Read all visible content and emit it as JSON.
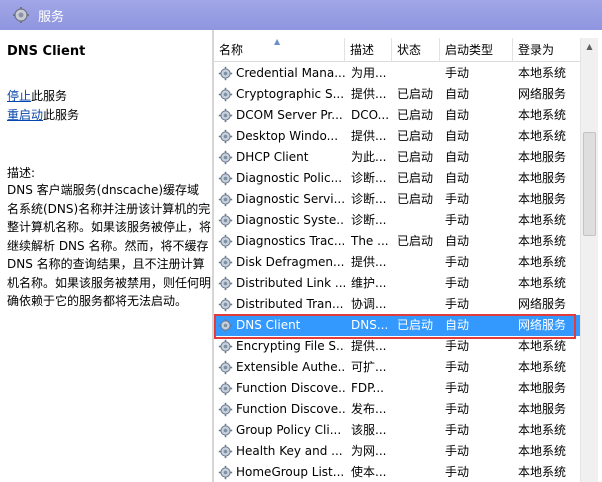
{
  "window": {
    "title": "服务",
    "title_icon": "gear-icon",
    "accent": "#969de1"
  },
  "detail": {
    "service_name": "DNS Client",
    "action_stop_link": "停止",
    "action_stop_suffix": "此服务",
    "action_restart_link": "重启动",
    "action_restart_suffix": "此服务",
    "description_label": "描述:",
    "description_text": "DNS 客户端服务(dnscache)缓存域名系统(DNS)名称并注册该计算机的完整计算机名称。如果该服务被停止，将继续解析 DNS 名称。然而，将不缓存 DNS 名称的查询结果，且不注册计算机名称。如果该服务被禁用，则任何明确依赖于它的服务都将无法启动。"
  },
  "columns": {
    "name": "名称",
    "desc": "描述",
    "status": "状态",
    "start": "启动类型",
    "logon": "登录为"
  },
  "rows": [
    {
      "name": "Credential Mana...",
      "desc": "为用...",
      "status": "",
      "start": "手动",
      "logon": "本地系统"
    },
    {
      "name": "Cryptographic S...",
      "desc": "提供...",
      "status": "已启动",
      "start": "自动",
      "logon": "网络服务"
    },
    {
      "name": "DCOM Server Pr...",
      "desc": "DCO...",
      "status": "已启动",
      "start": "自动",
      "logon": "本地系统"
    },
    {
      "name": "Desktop Windo...",
      "desc": "提供...",
      "status": "已启动",
      "start": "自动",
      "logon": "本地系统"
    },
    {
      "name": "DHCP Client",
      "desc": "为此...",
      "status": "已启动",
      "start": "自动",
      "logon": "本地服务"
    },
    {
      "name": "Diagnostic Polic...",
      "desc": "诊断...",
      "status": "已启动",
      "start": "自动",
      "logon": "本地服务"
    },
    {
      "name": "Diagnostic Servi...",
      "desc": "诊断...",
      "status": "已启动",
      "start": "手动",
      "logon": "本地服务"
    },
    {
      "name": "Diagnostic Syste...",
      "desc": "诊断...",
      "status": "",
      "start": "手动",
      "logon": "本地系统"
    },
    {
      "name": "Diagnostics Trac...",
      "desc": "The ...",
      "status": "已启动",
      "start": "自动",
      "logon": "本地系统"
    },
    {
      "name": "Disk Defragmen...",
      "desc": "提供...",
      "status": "",
      "start": "手动",
      "logon": "本地系统"
    },
    {
      "name": "Distributed Link ...",
      "desc": "维护...",
      "status": "",
      "start": "手动",
      "logon": "本地系统"
    },
    {
      "name": "Distributed Tran...",
      "desc": "协调...",
      "status": "",
      "start": "手动",
      "logon": "网络服务"
    },
    {
      "name": "DNS Client",
      "desc": "DNS...",
      "status": "已启动",
      "start": "自动",
      "logon": "网络服务",
      "selected": true
    },
    {
      "name": "Encrypting File S...",
      "desc": "提供...",
      "status": "",
      "start": "手动",
      "logon": "本地系统"
    },
    {
      "name": "Extensible Authe...",
      "desc": "可扩...",
      "status": "",
      "start": "手动",
      "logon": "本地系统"
    },
    {
      "name": "Function Discove...",
      "desc": "FDP...",
      "status": "",
      "start": "手动",
      "logon": "本地服务"
    },
    {
      "name": "Function Discove...",
      "desc": "发布...",
      "status": "",
      "start": "手动",
      "logon": "本地服务"
    },
    {
      "name": "Group Policy Cli...",
      "desc": "该服...",
      "status": "",
      "start": "手动",
      "logon": "本地系统"
    },
    {
      "name": "Health Key and ...",
      "desc": "为网...",
      "status": "",
      "start": "手动",
      "logon": "本地系统"
    },
    {
      "name": "HomeGroup List...",
      "desc": "使本...",
      "status": "",
      "start": "手动",
      "logon": "本地系统"
    }
  ],
  "colors": {
    "highlight_border": "#e23b3b",
    "selected_row": "#3399ff",
    "link": "#0645ad"
  }
}
